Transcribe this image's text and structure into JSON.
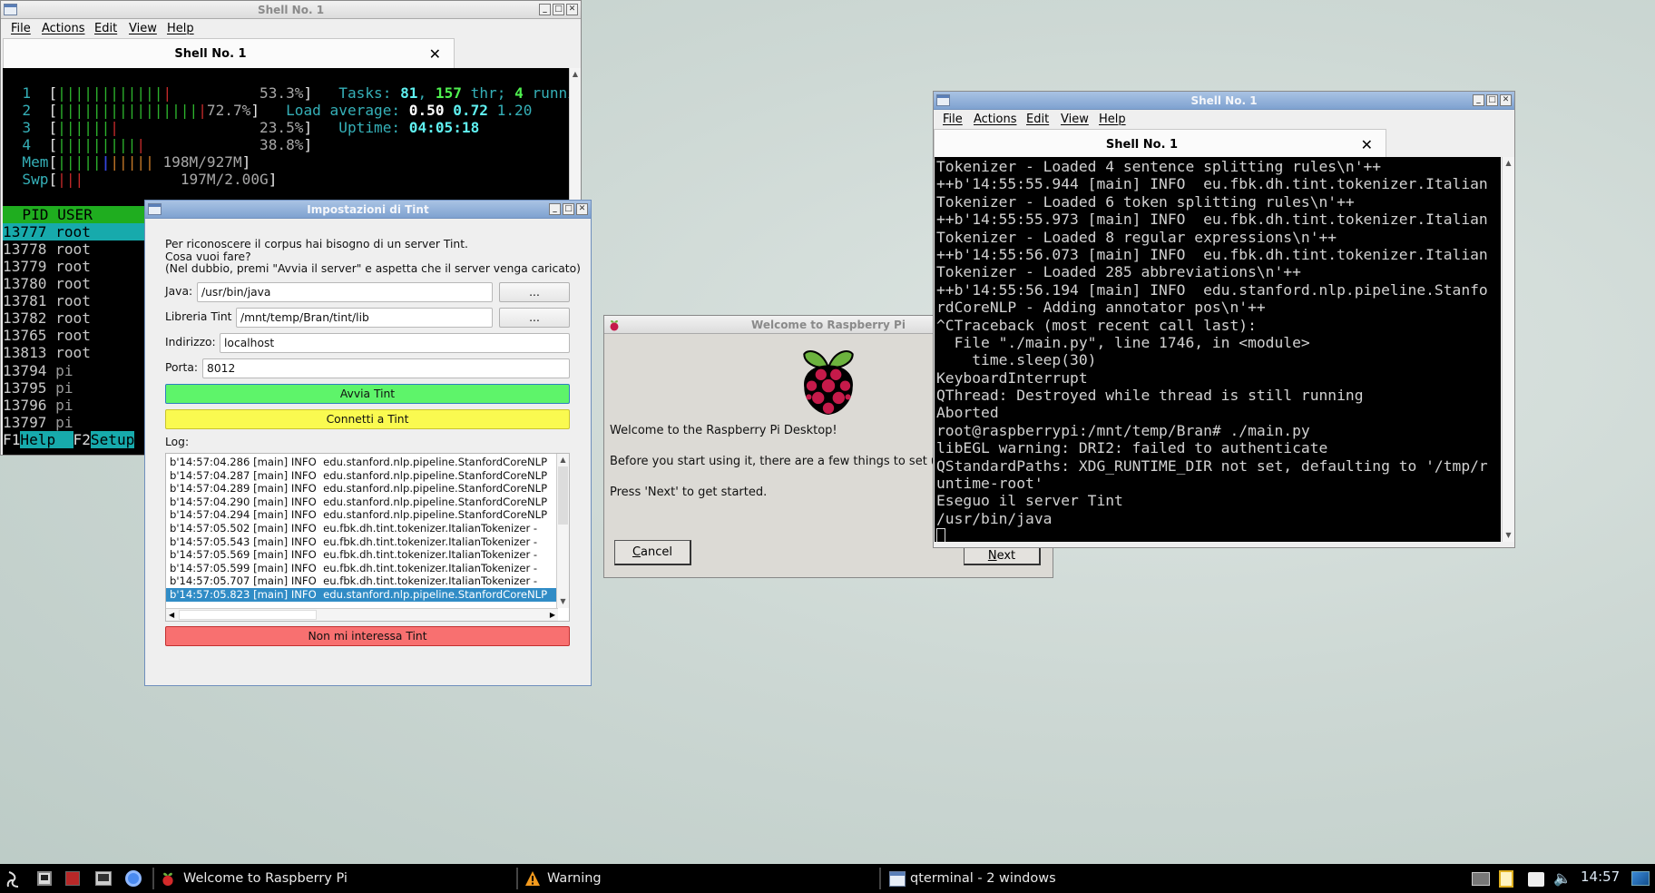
{
  "colors": {
    "desktop": "#c9d5d1",
    "dialog_accent": "#7fa2d0",
    "start_button": "#5ef46a",
    "connect_button": "#fafa50",
    "decline_button": "#f87070",
    "selection": "#308cc6",
    "htop_label": "#35b0b8",
    "htop_green": "#2db32d",
    "htop_red": "#c42a2a",
    "htop_blue": "#2244cc",
    "htop_orange": "#c87a28",
    "htop_cyan_bg": "#17aaac",
    "htop_header_bg": "#1fad1f"
  },
  "left_terminal": {
    "window_title": "Shell No. 1",
    "menu": [
      "File",
      "Actions",
      "Edit",
      "View",
      "Help"
    ],
    "tab_title": "Shell No. 1",
    "htop": {
      "meters": [
        [
          {
            "t": "  1  ",
            "c": "label"
          },
          {
            "t": "[",
            "c": "white"
          },
          {
            "t": "||||||||||||",
            "c": "green"
          },
          {
            "t": "|",
            "c": "red"
          },
          {
            "t": "          53.3%",
            "c": "grey"
          },
          {
            "t": "]",
            "c": "white"
          },
          {
            "t": "   Tasks: ",
            "c": "label"
          },
          {
            "t": "81",
            "c": "bcyan"
          },
          {
            "t": ", ",
            "c": "label"
          },
          {
            "t": "157",
            "c": "bgreen"
          },
          {
            "t": " thr; ",
            "c": "label"
          },
          {
            "t": "4",
            "c": "bgreen"
          },
          {
            "t": " running",
            "c": "label"
          }
        ],
        [
          {
            "t": "  2  ",
            "c": "label"
          },
          {
            "t": "[",
            "c": "white"
          },
          {
            "t": "||||||||||||||||",
            "c": "green"
          },
          {
            "t": "|",
            "c": "red"
          },
          {
            "t": "72.7%",
            "c": "grey"
          },
          {
            "t": "]",
            "c": "white"
          },
          {
            "t": "   Load average: ",
            "c": "label"
          },
          {
            "t": "0.50 ",
            "c": "bwhite"
          },
          {
            "t": "0.72 ",
            "c": "bcyan"
          },
          {
            "t": "1.20",
            "c": "label"
          }
        ],
        [
          {
            "t": "  3  ",
            "c": "label"
          },
          {
            "t": "[",
            "c": "white"
          },
          {
            "t": "||||||",
            "c": "green"
          },
          {
            "t": "|",
            "c": "red"
          },
          {
            "t": "                23.5%",
            "c": "grey"
          },
          {
            "t": "]",
            "c": "white"
          },
          {
            "t": "   Uptime: ",
            "c": "label"
          },
          {
            "t": "04:05:18",
            "c": "bcyan"
          }
        ],
        [
          {
            "t": "  4  ",
            "c": "label"
          },
          {
            "t": "[",
            "c": "white"
          },
          {
            "t": "|||||||||",
            "c": "green"
          },
          {
            "t": "|",
            "c": "red"
          },
          {
            "t": "             38.8%",
            "c": "grey"
          },
          {
            "t": "]",
            "c": "white"
          }
        ],
        [
          {
            "t": "  Mem",
            "c": "label"
          },
          {
            "t": "[",
            "c": "white"
          },
          {
            "t": "|||||",
            "c": "green"
          },
          {
            "t": "|",
            "c": "blue"
          },
          {
            "t": "|||||",
            "c": "orange"
          },
          {
            "t": " 198M/927M",
            "c": "grey"
          },
          {
            "t": "]",
            "c": "white"
          }
        ],
        [
          {
            "t": "  Swp",
            "c": "label"
          },
          {
            "t": "[",
            "c": "white"
          },
          {
            "t": "|||",
            "c": "red"
          },
          {
            "t": "           197M/2.00G",
            "c": "grey"
          },
          {
            "t": "]",
            "c": "white"
          }
        ]
      ],
      "header": "  PID USER",
      "processes": [
        {
          "pid": "13777",
          "user": "root",
          "selected": true
        },
        {
          "pid": "13778",
          "user": "root"
        },
        {
          "pid": "13779",
          "user": "root"
        },
        {
          "pid": "13780",
          "user": "root"
        },
        {
          "pid": "13781",
          "user": "root"
        },
        {
          "pid": "13782",
          "user": "root"
        },
        {
          "pid": "13765",
          "user": "root"
        },
        {
          "pid": "13813",
          "user": "root"
        },
        {
          "pid": "13794",
          "user": "pi"
        },
        {
          "pid": "13795",
          "user": "pi"
        },
        {
          "pid": "13796",
          "user": "pi"
        },
        {
          "pid": "13797",
          "user": "pi"
        }
      ],
      "fkeys": [
        {
          "key": "F1",
          "label": "Help  "
        },
        {
          "key": "F2",
          "label": "Setup"
        }
      ]
    }
  },
  "tint_dialog": {
    "title": "Impostazioni di Tint",
    "intro": [
      "Per riconoscere il corpus hai bisogno di un server Tint.",
      "Cosa vuoi fare?",
      "(Nel dubbio, premi \"Avvia il server\" e aspetta che il server venga caricato)"
    ],
    "java_label": "Java:",
    "java_value": "/usr/bin/java",
    "lib_label": "Libreria Tint",
    "lib_value": "/mnt/temp/Bran/tint/lib",
    "browse_label": "...",
    "address_label": "Indirizzo:",
    "address_value": "localhost",
    "port_label": "Porta:",
    "port_value": "8012",
    "start_button": "Avvia Tint",
    "connect_button": "Connetti a Tint",
    "log_label": "Log:",
    "log": [
      "b'14:57:04.286 [main] INFO  edu.stanford.nlp.pipeline.StanfordCoreNLP",
      "b'14:57:04.287 [main] INFO  edu.stanford.nlp.pipeline.StanfordCoreNLP",
      "b'14:57:04.289 [main] INFO  edu.stanford.nlp.pipeline.StanfordCoreNLP",
      "b'14:57:04.290 [main] INFO  edu.stanford.nlp.pipeline.StanfordCoreNLP",
      "b'14:57:04.294 [main] INFO  edu.stanford.nlp.pipeline.StanfordCoreNLP",
      "b'14:57:05.502 [main] INFO  eu.fbk.dh.tint.tokenizer.ItalianTokenizer -",
      "b'14:57:05.543 [main] INFO  eu.fbk.dh.tint.tokenizer.ItalianTokenizer -",
      "b'14:57:05.569 [main] INFO  eu.fbk.dh.tint.tokenizer.ItalianTokenizer -",
      "b'14:57:05.599 [main] INFO  eu.fbk.dh.tint.tokenizer.ItalianTokenizer -",
      "b'14:57:05.707 [main] INFO  eu.fbk.dh.tint.tokenizer.ItalianTokenizer -",
      "b'14:57:05.823 [main] INFO  edu.stanford.nlp.pipeline.StanfordCoreNLP"
    ],
    "log_selected_index": 10,
    "decline_button": "Non mi interessa Tint"
  },
  "raspberry_dialog": {
    "title": "Welcome to Raspberry Pi",
    "lines": [
      "Welcome to the Raspberry Pi Desktop!",
      "Before you start using it, there are a few things to set up.",
      "Press 'Next' to get started."
    ],
    "cancel_mnemonic": "C",
    "cancel_rest": "ancel",
    "next_mnemonic": "N",
    "next_rest": "ext"
  },
  "right_terminal": {
    "window_title": "Shell No. 1",
    "menu": [
      "File",
      "Actions",
      "Edit",
      "View",
      "Help"
    ],
    "tab_title": "Shell No. 1",
    "lines": [
      "Tokenizer - Loaded 4 sentence splitting rules\\n'++",
      "++b'14:55:55.944 [main] INFO  eu.fbk.dh.tint.tokenizer.Italian",
      "Tokenizer - Loaded 6 token splitting rules\\n'++",
      "++b'14:55:55.973 [main] INFO  eu.fbk.dh.tint.tokenizer.Italian",
      "Tokenizer - Loaded 8 regular expressions\\n'++",
      "++b'14:55:56.073 [main] INFO  eu.fbk.dh.tint.tokenizer.Italian",
      "Tokenizer - Loaded 285 abbreviations\\n'++",
      "++b'14:55:56.194 [main] INFO  edu.stanford.nlp.pipeline.Stanfo",
      "rdCoreNLP - Adding annotator pos\\n'++",
      "^CTraceback (most recent call last):",
      "  File \"./main.py\", line 1746, in <module>",
      "    time.sleep(30)",
      "KeyboardInterrupt",
      "QThread: Destroyed while thread is still running",
      "Aborted",
      "root@raspberrypi:/mnt/temp/Bran# ./main.py",
      "libEGL warning: DRI2: failed to authenticate",
      "QStandardPaths: XDG_RUNTIME_DIR not set, defaulting to '/tmp/r",
      "untime-root'",
      "Eseguo il server Tint",
      "/usr/bin/java"
    ]
  },
  "taskbar": {
    "launchers": [
      "menu-icon",
      "terminal-icon",
      "red-app-icon",
      "task-manager-icon",
      "chromium-icon"
    ],
    "tasks": [
      {
        "icon": "raspberry-icon",
        "label": "Welcome to Raspberry Pi"
      },
      {
        "icon": "warning-icon",
        "label": "Warning"
      },
      {
        "icon": "terminal-window-icon",
        "label": "qterminal - 2 windows"
      }
    ],
    "tray": [
      "network-icon",
      "clipboard-icon",
      "drive-icon",
      "volume-icon"
    ],
    "clock": "14:57"
  }
}
